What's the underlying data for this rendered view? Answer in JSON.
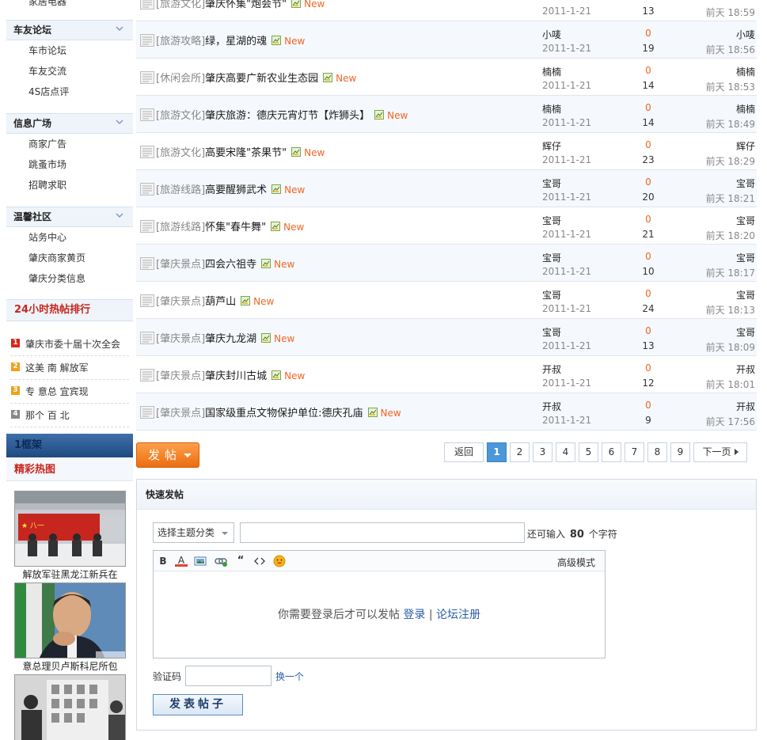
{
  "sidebar": {
    "top_item": "家居电器",
    "groups": [
      {
        "title": "车友论坛",
        "items": [
          "车市论坛",
          "车友交流",
          "4S店点评"
        ]
      },
      {
        "title": "信息广场",
        "items": [
          "商家广告",
          "跳蚤市场",
          "招聘求职"
        ]
      },
      {
        "title": "温馨社区",
        "items": [
          "站务中心",
          "肇庆商家黄页",
          "肇庆分类信息"
        ]
      }
    ],
    "hot_title": "24小时热帖排行",
    "hot_items": [
      {
        "rank": "1",
        "text": "肇庆市委十届十次全会",
        "color": "#d7261c"
      },
      {
        "rank": "2",
        "text": "这美     南      解放军",
        "color": "#f0a020"
      },
      {
        "rank": "3",
        "text": "专      意总     宜宾现",
        "color": "#f0a020"
      },
      {
        "rank": "4",
        "text": "那个      百       北",
        "color": "#888888"
      }
    ],
    "frame_label": "1框架",
    "pictures_title": "精彩热图",
    "pictures": [
      {
        "caption": "解放军驻黑龙江新兵在"
      },
      {
        "caption": "意总理贝卢斯科尼所包"
      },
      {
        "caption": ""
      }
    ]
  },
  "threads": [
    {
      "category": "[旅游文化]",
      "subject": "肇庆怀集\"炮会节\"",
      "new": "New",
      "author": "",
      "date": "2011-1-21",
      "replies": "",
      "views": "13",
      "last_user": "",
      "last_time": "前天 18:59"
    },
    {
      "category": "[旅游攻略]",
      "subject": "绿，星湖的魂",
      "new": "New",
      "author": "小唛",
      "date": "2011-1-21",
      "replies": "0",
      "views": "19",
      "last_user": "小唛",
      "last_time": "前天 18:56"
    },
    {
      "category": "[休闲会所]",
      "subject": "肇庆高要广新农业生态园",
      "new": "New",
      "author": "楠楠",
      "date": "2011-1-21",
      "replies": "0",
      "views": "14",
      "last_user": "楠楠",
      "last_time": "前天 18:53"
    },
    {
      "category": "[旅游文化]",
      "subject": "肇庆旅游：德庆元宵灯节【炸狮头】",
      "new": "New",
      "author": "楠楠",
      "date": "2011-1-21",
      "replies": "0",
      "views": "14",
      "last_user": "楠楠",
      "last_time": "前天 18:49"
    },
    {
      "category": "[旅游文化]",
      "subject": "高要宋隆\"茶果节\"",
      "new": "New",
      "author": "辉仔",
      "date": "2011-1-21",
      "replies": "0",
      "views": "23",
      "last_user": "辉仔",
      "last_time": "前天 18:29"
    },
    {
      "category": "[旅游线路]",
      "subject": "高要醒狮武术",
      "new": "New",
      "author": "宝哥",
      "date": "2011-1-21",
      "replies": "0",
      "views": "20",
      "last_user": "宝哥",
      "last_time": "前天 18:21"
    },
    {
      "category": "[旅游线路]",
      "subject": "怀集\"春牛舞\"",
      "new": "New",
      "author": "宝哥",
      "date": "2011-1-21",
      "replies": "0",
      "views": "21",
      "last_user": "宝哥",
      "last_time": "前天 18:20"
    },
    {
      "category": "[肇庆景点]",
      "subject": "四会六祖寺",
      "new": "New",
      "author": "宝哥",
      "date": "2011-1-21",
      "replies": "0",
      "views": "10",
      "last_user": "宝哥",
      "last_time": "前天 18:17"
    },
    {
      "category": "[肇庆景点]",
      "subject": "葫芦山",
      "new": "New",
      "author": "宝哥",
      "date": "2011-1-21",
      "replies": "0",
      "views": "24",
      "last_user": "宝哥",
      "last_time": "前天 18:13"
    },
    {
      "category": "[肇庆景点]",
      "subject": "肇庆九龙湖",
      "new": "New",
      "author": "宝哥",
      "date": "2011-1-21",
      "replies": "0",
      "views": "13",
      "last_user": "宝哥",
      "last_time": "前天 18:09"
    },
    {
      "category": "[肇庆景点]",
      "subject": "肇庆封川古城",
      "new": "New",
      "author": "开叔",
      "date": "2011-1-21",
      "replies": "0",
      "views": "12",
      "last_user": "开叔",
      "last_time": "前天 18:01"
    },
    {
      "category": "[肇庆景点]",
      "subject": "国家级重点文物保护单位:德庆孔庙",
      "new": "New",
      "author": "开叔",
      "date": "2011-1-21",
      "replies": "0",
      "views": "9",
      "last_user": "开叔",
      "last_time": "前天 17:56"
    }
  ],
  "post_button": "发帖",
  "pager": {
    "back": "返回",
    "pages": [
      "1",
      "2",
      "3",
      "4",
      "5",
      "6",
      "7",
      "8",
      "9"
    ],
    "current": "1",
    "next": "下一页"
  },
  "quick_post": {
    "title": "快速发帖",
    "category_select": "选择主题分类",
    "subject_value": "",
    "remain_prefix": "还可输入",
    "remain_count": "80",
    "remain_suffix": "个字符",
    "toolbar": {
      "bold": "B",
      "font_color": "A",
      "advanced": "高级模式"
    },
    "login_notice": "你需要登录后才可以发帖",
    "login_link": "登录",
    "separator": "|",
    "register_link": "论坛注册",
    "captcha_label": "验证码",
    "captcha_value": "",
    "captcha_change": "换一个",
    "submit": "发表帖子"
  },
  "colors": {
    "accent_orange": "#f26522",
    "link_blue": "#2a5ca8",
    "hot_red": "#c8251d",
    "pager_current": "#4b97d8"
  }
}
